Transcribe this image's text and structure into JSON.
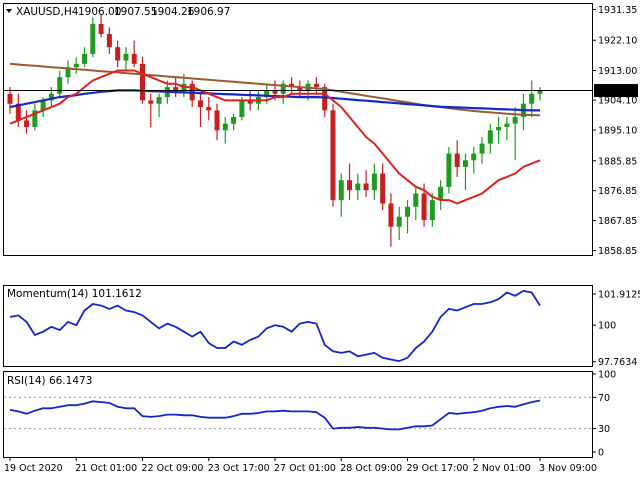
{
  "header": {
    "symbol": "XAUUSD,H4",
    "open": "1906.00",
    "high": "1907.55",
    "low": "1904.26",
    "close": "1906.97"
  },
  "colors": {
    "bull": "#1f9b1f",
    "bear": "#c81e1e",
    "ma_fast": "#e0211c",
    "ma_mid": "#1228c8",
    "ma_slow": "#9c5a32",
    "indicator": "#1228c8",
    "grid_dot": "#9a9a9a",
    "price_line": "#000000"
  },
  "chart_data": [
    {
      "type": "candlestick",
      "title": "XAUUSD,H4",
      "yticks": [
        "1931.35",
        "1922.10",
        "1913.00",
        "1904.10",
        "1895.10",
        "1885.85",
        "1876.85",
        "1867.85",
        "1858.85"
      ],
      "ylim": [
        1857.5,
        1933.0
      ],
      "current_price": "1906.97",
      "xlabels": [
        "19 Oct 2020",
        "21 Oct 01:00",
        "22 Oct 09:00",
        "23 Oct 17:00",
        "27 Oct 01:00",
        "28 Oct 09:00",
        "29 Oct 17:00",
        "2 Nov 01:00",
        "3 Nov 09:00"
      ],
      "candles": [
        [
          1906,
          1908,
          1900,
          1903
        ],
        [
          1903,
          1906,
          1896,
          1898
        ],
        [
          1898,
          1901,
          1894,
          1896
        ],
        [
          1896,
          1903,
          1895,
          1901
        ],
        [
          1901,
          1905,
          1899,
          1904
        ],
        [
          1904,
          1908,
          1902,
          1906
        ],
        [
          1906,
          1913,
          1905,
          1911
        ],
        [
          1911,
          1916,
          1909,
          1914
        ],
        [
          1914,
          1917,
          1912,
          1915
        ],
        [
          1915,
          1920,
          1914,
          1918
        ],
        [
          1918,
          1929,
          1917,
          1927
        ],
        [
          1927,
          1930,
          1923,
          1924
        ],
        [
          1924,
          1926,
          1918,
          1920
        ],
        [
          1920,
          1922,
          1914,
          1916
        ],
        [
          1916,
          1920,
          1913,
          1918
        ],
        [
          1918,
          1922,
          1914,
          1915
        ],
        [
          1915,
          1917,
          1903,
          1904
        ],
        [
          1904,
          1906,
          1896,
          1903
        ],
        [
          1903,
          1906,
          1899,
          1905
        ],
        [
          1905,
          1910,
          1903,
          1908
        ],
        [
          1908,
          1911,
          1905,
          1907
        ],
        [
          1907,
          1912,
          1905,
          1909
        ],
        [
          1909,
          1910,
          1902,
          1904
        ],
        [
          1904,
          1906,
          1896,
          1902
        ],
        [
          1902,
          1905,
          1898,
          1901
        ],
        [
          1901,
          1903,
          1892,
          1895
        ],
        [
          1895,
          1899,
          1891,
          1897
        ],
        [
          1897,
          1900,
          1895,
          1899
        ],
        [
          1899,
          1905,
          1898,
          1904
        ],
        [
          1904,
          1907,
          1901,
          1903
        ],
        [
          1903,
          1907,
          1901,
          1905
        ],
        [
          1905,
          1909,
          1903,
          1907
        ],
        [
          1907,
          1910,
          1904,
          1906
        ],
        [
          1906,
          1910,
          1903,
          1909
        ],
        [
          1909,
          1911,
          1906,
          1908
        ],
        [
          1908,
          1910,
          1905,
          1907
        ],
        [
          1907,
          1910,
          1904,
          1909
        ],
        [
          1909,
          1911,
          1906,
          1908
        ],
        [
          1908,
          1909,
          1899,
          1901
        ],
        [
          1901,
          1903,
          1872,
          1874
        ],
        [
          1874,
          1882,
          1869,
          1880
        ],
        [
          1880,
          1885,
          1874,
          1877
        ],
        [
          1877,
          1882,
          1874,
          1879
        ],
        [
          1879,
          1883,
          1875,
          1877
        ],
        [
          1877,
          1885,
          1874,
          1882
        ],
        [
          1882,
          1885,
          1871,
          1873
        ],
        [
          1873,
          1876,
          1860,
          1866
        ],
        [
          1866,
          1872,
          1862,
          1869
        ],
        [
          1869,
          1874,
          1864,
          1872
        ],
        [
          1872,
          1878,
          1868,
          1876
        ],
        [
          1876,
          1879,
          1866,
          1868
        ],
        [
          1868,
          1876,
          1866,
          1874
        ],
        [
          1874,
          1880,
          1871,
          1878
        ],
        [
          1878,
          1890,
          1876,
          1888
        ],
        [
          1888,
          1892,
          1881,
          1884
        ],
        [
          1884,
          1888,
          1877,
          1886
        ],
        [
          1886,
          1890,
          1882,
          1888
        ],
        [
          1888,
          1893,
          1885,
          1891
        ],
        [
          1891,
          1897,
          1888,
          1895
        ],
        [
          1895,
          1899,
          1891,
          1896
        ],
        [
          1896,
          1899,
          1892,
          1897
        ],
        [
          1897,
          1902,
          1886,
          1899
        ],
        [
          1899,
          1906,
          1895,
          1903
        ],
        [
          1903,
          1910,
          1899,
          1906
        ],
        [
          1906,
          1908,
          1904,
          1907
        ]
      ],
      "ma_fast": [
        1897,
        1898,
        1899,
        1900,
        1901,
        1902,
        1903,
        1905,
        1906,
        1908,
        1910,
        1911,
        1912,
        1913,
        1913,
        1913,
        1912,
        1911,
        1910,
        1909,
        1909,
        1908,
        1908,
        1907,
        1906,
        1905,
        1904,
        1904,
        1904,
        1904,
        1904,
        1904,
        1905,
        1905,
        1906,
        1906,
        1906,
        1906,
        1906,
        1904,
        1902,
        1899,
        1896,
        1893,
        1891,
        1888,
        1885,
        1882,
        1880,
        1878,
        1877,
        1875,
        1874,
        1874,
        1873,
        1874,
        1875,
        1876,
        1878,
        1880,
        1881,
        1882,
        1884,
        1885,
        1886
      ],
      "ma_mid": [
        1902,
        1902.5,
        1903,
        1903.5,
        1904,
        1904.5,
        1905,
        1905.3,
        1905.6,
        1906,
        1906.3,
        1906.6,
        1906.8,
        1907,
        1907,
        1907,
        1906.9,
        1906.8,
        1906.7,
        1906.6,
        1906.5,
        1906.4,
        1906.3,
        1906.2,
        1906.1,
        1906,
        1905.9,
        1905.8,
        1905.7,
        1905.6,
        1905.5,
        1905.4,
        1905.3,
        1905.2,
        1905.1,
        1905,
        1905,
        1905,
        1904.9,
        1904.7,
        1904.5,
        1904.3,
        1904.1,
        1903.9,
        1903.7,
        1903.5,
        1903.3,
        1903.1,
        1902.9,
        1902.7,
        1902.5,
        1902.3,
        1902.1,
        1902,
        1901.9,
        1901.8,
        1901.7,
        1901.6,
        1901.5,
        1901.4,
        1901.3,
        1901.2,
        1901.1,
        1901,
        1901
      ],
      "ma_slow": [
        1915,
        1914.8,
        1914.6,
        1914.4,
        1914.2,
        1914,
        1913.8,
        1913.6,
        1913.4,
        1913.2,
        1913,
        1912.8,
        1912.6,
        1912.4,
        1912.2,
        1912,
        1911.8,
        1911.6,
        1911.4,
        1911.2,
        1911,
        1910.8,
        1910.6,
        1910.4,
        1910.2,
        1910,
        1909.8,
        1909.6,
        1909.4,
        1909.2,
        1909,
        1908.8,
        1908.6,
        1908.4,
        1908.2,
        1908,
        1907.8,
        1907.6,
        1907.4,
        1907,
        1906.6,
        1906.2,
        1905.8,
        1905.4,
        1905,
        1904.6,
        1904.2,
        1903.8,
        1903.4,
        1903,
        1902.6,
        1902.3,
        1902,
        1901.7,
        1901.4,
        1901.1,
        1900.8,
        1900.6,
        1900.4,
        1900.2,
        1900,
        1899.8,
        1899.7,
        1899.6,
        1899.5
      ]
    },
    {
      "type": "line",
      "title": "Momentum(14) 101.1612",
      "yticks": [
        "101.9125",
        "100",
        "97.7634"
      ],
      "ylim": [
        97.5,
        102.4
      ],
      "values": [
        100.5,
        100.6,
        100.2,
        99.4,
        99.6,
        99.9,
        99.7,
        100.2,
        100.0,
        100.9,
        101.3,
        101.2,
        101.0,
        101.2,
        100.9,
        100.8,
        100.6,
        100.2,
        99.8,
        100.1,
        99.9,
        99.6,
        99.3,
        99.6,
        98.9,
        98.6,
        98.6,
        99.0,
        98.8,
        99.1,
        99.3,
        99.8,
        100.0,
        99.9,
        99.6,
        100.1,
        100.2,
        100.1,
        98.8,
        98.4,
        98.3,
        98.4,
        98.1,
        98.2,
        98.3,
        98.0,
        97.9,
        97.8,
        98.0,
        98.6,
        99.0,
        99.6,
        100.5,
        101.0,
        100.9,
        101.1,
        101.3,
        101.3,
        101.4,
        101.6,
        102.0,
        101.8,
        102.1,
        102.0,
        101.2
      ],
      "current": "101.1612"
    },
    {
      "type": "line",
      "title": "RSI(14) 66.1473",
      "yticks": [
        "100",
        "70",
        "30",
        "0"
      ],
      "levels": [
        70,
        30
      ],
      "ylim": [
        0,
        100
      ],
      "values": [
        54,
        52,
        49,
        53,
        56,
        56,
        58,
        60,
        60,
        62,
        65,
        64,
        63,
        58,
        56,
        56,
        46,
        45,
        46,
        48,
        48,
        47,
        47,
        45,
        44,
        44,
        44,
        46,
        49,
        49,
        50,
        52,
        52,
        53,
        52,
        52,
        52,
        51,
        44,
        30,
        31,
        31,
        32,
        31,
        31,
        30,
        29,
        29,
        31,
        33,
        33,
        34,
        42,
        50,
        49,
        50,
        51,
        53,
        56,
        58,
        59,
        58,
        61,
        64,
        66
      ],
      "current": "66.1473"
    }
  ]
}
